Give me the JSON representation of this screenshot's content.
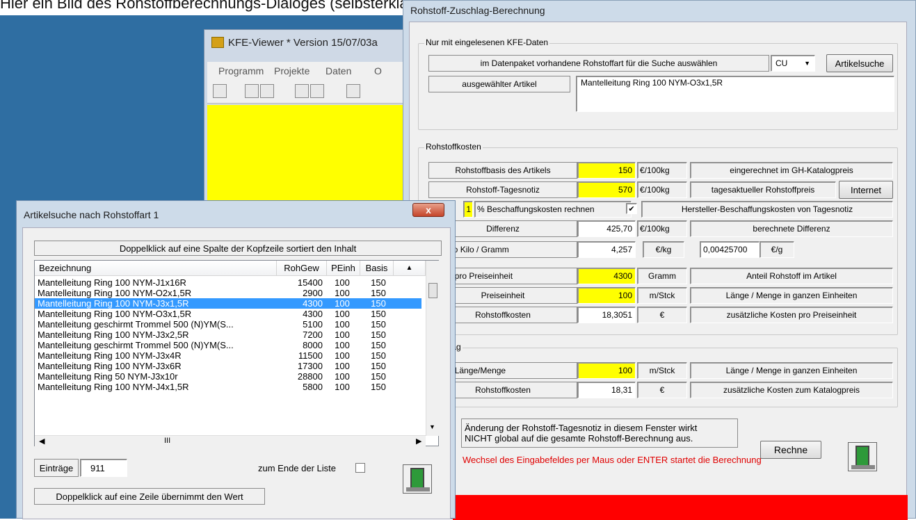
{
  "caption": "Hier ein Bild des Rohstoffberechnungs-Dialoges (selbsterklärend)",
  "kfe": {
    "title": "KFE-Viewer * Version 15/07/03a",
    "menu": [
      "Programm",
      "Projekte",
      "Daten",
      "O"
    ]
  },
  "rohstoff": {
    "title": "Rohstoff-Zuschlag-Berechnung",
    "group1": {
      "label": "Nur mit eingelesenen KFE-Daten",
      "search_label": "im Datenpaket vorhandene Rohstoffart für die Suche auswählen",
      "select_value": "CU",
      "search_button": "Artikelsuche",
      "article_label": "ausgewählter Artikel",
      "article_value": "Mantelleitung Ring 100 NYM-O3x1,5R"
    },
    "group2": {
      "label": "Rohstoffkosten",
      "basis_label": "Rohstoffbasis des Artikels",
      "basis_value": "150",
      "basis_unit": "€/100kg",
      "basis_desc": "eingerechnet im GH-Katalogpreis",
      "notiz_label": "Rohstoff-Tagesnotiz",
      "notiz_value": "570",
      "notiz_unit": "€/100kg",
      "notiz_desc": "tagesaktueller Rohstoffpreis",
      "internet_button": "Internet",
      "bkosten_value": "1",
      "bkosten_label": "% Beschaffungskosten rechnen",
      "bkosten_check": "✔",
      "bkosten_desc": "Hersteller-Beschaffungskosten von Tagesnotiz",
      "diff_label": "Differenz",
      "diff_value": "425,70",
      "diff_unit": "€/100kg",
      "diff_desc": "berechnete Differenz",
      "kilo_label": "ten pro Kilo / Gramm",
      "kilo_value": "4,257",
      "kilo_unit": "€/kg",
      "gramm_value": "0,00425700",
      "gramm_unit": "€/g",
      "gewicht_label": "wicht pro Preiseinheit",
      "gewicht_value": "4300",
      "gewicht_unit": "Gramm",
      "gewicht_desc": "Anteil Rohstoff im Artikel",
      "pe_label": "Preiseinheit",
      "pe_value": "100",
      "pe_unit": "m/Stck",
      "pe_desc": "Länge / Menge in ganzen Einheiten",
      "rk_label": "Rohstoffkosten",
      "rk_value": "18,3051",
      "rk_unit": "€",
      "rk_desc": "zusätzliche Kosten pro Preiseinheit"
    },
    "group3": {
      "label": "fzuschlag",
      "len_label": "ötigte Länge/Menge",
      "len_value": "100",
      "len_unit": "m/Stck",
      "len_desc": "Länge / Menge in ganzen Einheiten",
      "rk_label": "Rohstoffkosten",
      "rk_value": "18,31",
      "rk_unit": "€",
      "rk_desc": "zusätzliche Kosten zum Katalogpreis"
    },
    "note_line1": "Änderung der Rohstoff-Tagesnotiz in diesem Fenster wirkt",
    "note_line2": "NICHT global auf die gesamte Rohstoff-Berechnung aus.",
    "rechne_button": "Rechne",
    "red_hint": "Wechsel des Eingabefeldes per Maus oder ENTER startet die Berechnung"
  },
  "dialog": {
    "title": "Artikelsuche nach Rohstoffart 1",
    "close_label": "x",
    "sort_hint": "Doppelklick auf eine Spalte der Kopfzeile sortiert den Inhalt",
    "columns": [
      "Bezeichnung",
      "RohGew",
      "PEinh",
      "Basis"
    ],
    "rows": [
      [
        "Mantelleitung Ring 100 NYM-J1x16R",
        "15400",
        "100",
        "150"
      ],
      [
        "Mantelleitung Ring 100 NYM-O2x1,5R",
        "2900",
        "100",
        "150"
      ],
      [
        "Mantelleitung Ring 100 NYM-J3x1,5R",
        "4300",
        "100",
        "150"
      ],
      [
        "Mantelleitung Ring 100 NYM-O3x1,5R",
        "4300",
        "100",
        "150"
      ],
      [
        "Mantelleitung geschirmt Trommel 500 (N)YM(S...",
        "5100",
        "100",
        "150"
      ],
      [
        "Mantelleitung Ring 100 NYM-J3x2,5R",
        "7200",
        "100",
        "150"
      ],
      [
        "Mantelleitung geschirmt Trommel 500 (N)YM(S...",
        "8000",
        "100",
        "150"
      ],
      [
        "Mantelleitung Ring 100 NYM-J3x4R",
        "11500",
        "100",
        "150"
      ],
      [
        "Mantelleitung Ring 100 NYM-J3x6R",
        "17300",
        "100",
        "150"
      ],
      [
        "Mantelleitung Ring 50 NYM-J3x10r",
        "28800",
        "100",
        "150"
      ],
      [
        "Mantelleitung Ring 100 NYM-J4x1,5R",
        "5800",
        "100",
        "150"
      ]
    ],
    "selected_row": 2,
    "scroll_grip": "III",
    "entries_label": "Einträge",
    "entries_value": "911",
    "end_label": "zum Ende der Liste",
    "row_hint": "Doppelklick auf eine Zeile übernimmt den Wert"
  }
}
